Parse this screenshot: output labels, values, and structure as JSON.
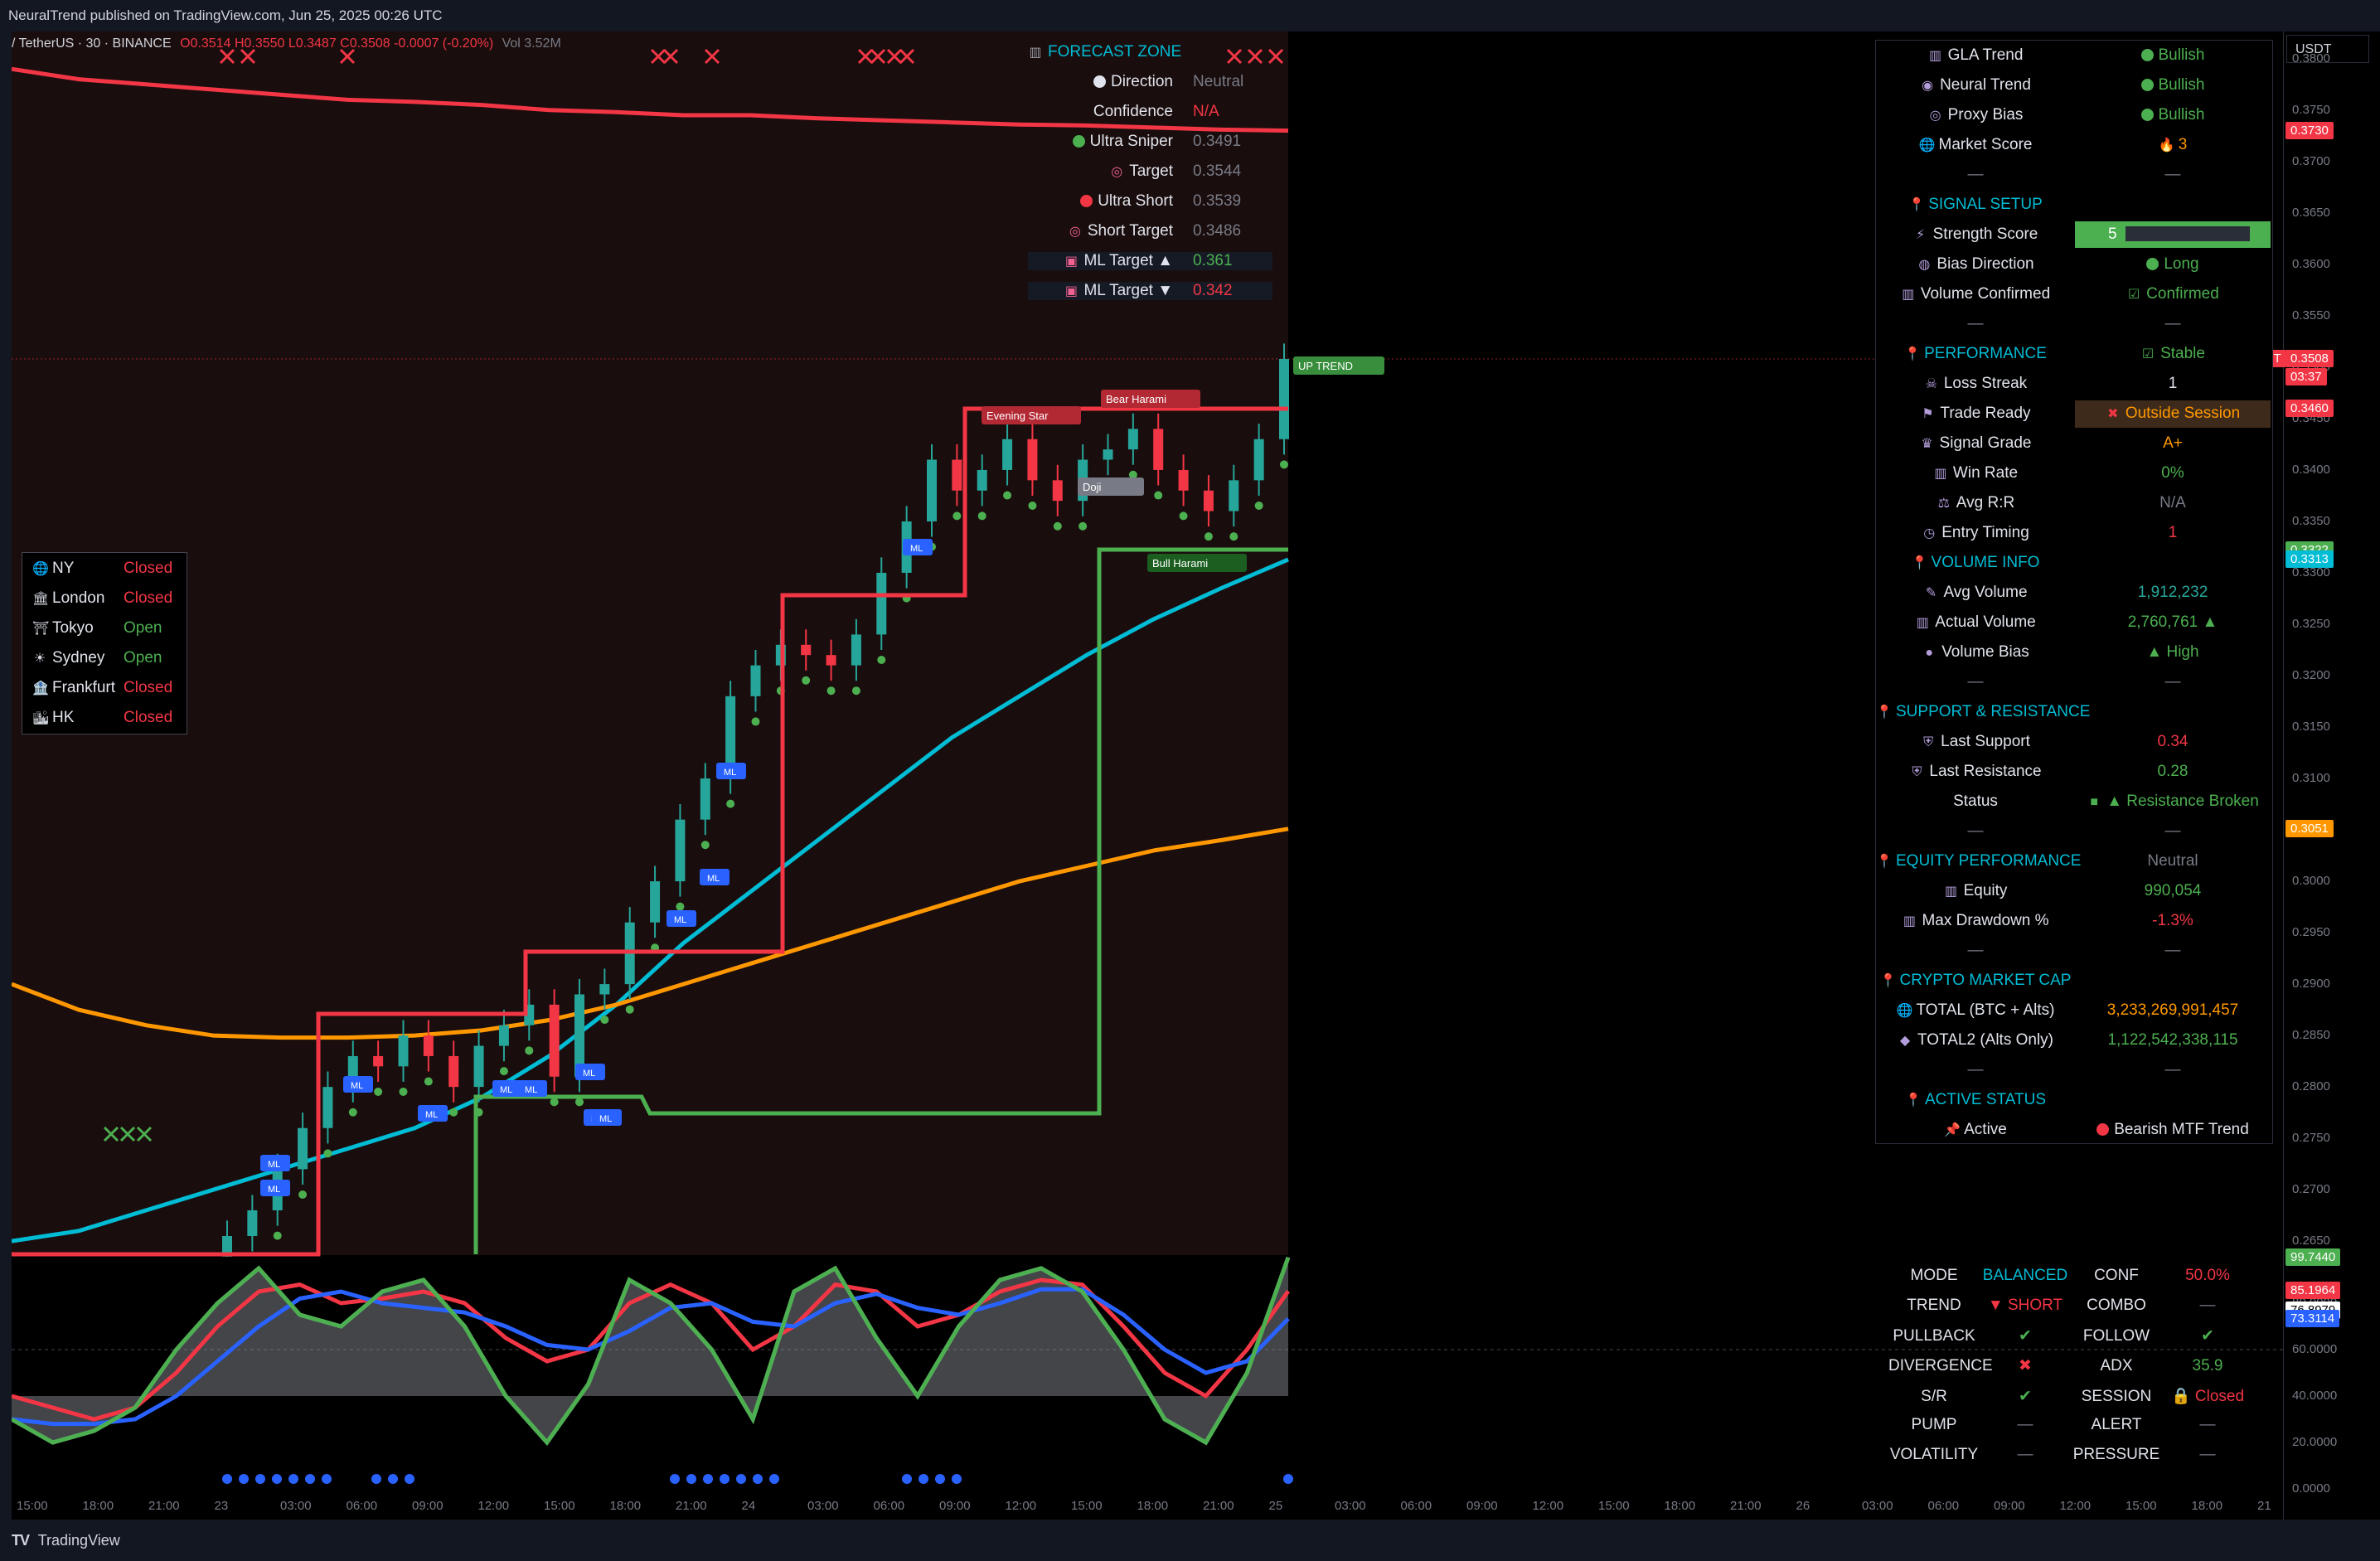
{
  "header": {
    "publisher": "NeuralTrend published on TradingView.com, Jun 25, 2025 00:26 UTC"
  },
  "symbol": {
    "name": "/ TetherUS · 30 · BINANCE",
    "ohlc": "O0.3514 H0.3550 L0.3487 C0.3508 -0.0007 (-0.20%)",
    "vol": "Vol 3.52M"
  },
  "currency": "USDT",
  "price_ticks": [
    "0.3800",
    "0.3750",
    "0.3700",
    "0.3650",
    "0.3600",
    "0.3550",
    "0.3500",
    "0.3450",
    "0.3400",
    "0.3350",
    "0.3300",
    "0.3250",
    "0.3200",
    "0.3150",
    "0.3100",
    "0.3050",
    "0.3000",
    "0.2950",
    "0.2900",
    "0.2850",
    "0.2800",
    "0.2750",
    "0.2700",
    "0.2650"
  ],
  "price_labels": [
    {
      "text": "0.3730",
      "color": "#f23645"
    },
    {
      "text": "SUSDT",
      "color": "#f23645"
    },
    {
      "text": "0.3508",
      "color": "#f23645"
    },
    {
      "text": "03:37",
      "color": "#f23645"
    },
    {
      "text": "0.3460",
      "color": "#f23645"
    },
    {
      "text": "0.3322",
      "color": "#4caf50"
    },
    {
      "text": "0.3313",
      "color": "#00bcd4"
    },
    {
      "text": "0.3051",
      "color": "#ff9800"
    }
  ],
  "osc_ticks": [
    "80.0000",
    "60.0000",
    "40.0000",
    "20.0000",
    "0.0000"
  ],
  "osc_labels": [
    {
      "text": "99.7440",
      "color": "#4caf50"
    },
    {
      "text": "85.1964",
      "color": "#f23645"
    },
    {
      "text": "76.8979",
      "color": "#ffffff",
      "fg": "#000"
    },
    {
      "text": "73.3114",
      "color": "#2962ff"
    }
  ],
  "time_axis": [
    "15:00",
    "18:00",
    "21:00",
    "23",
    "03:00",
    "06:00",
    "09:00",
    "12:00",
    "15:00",
    "18:00",
    "21:00",
    "24",
    "03:00",
    "06:00",
    "09:00",
    "12:00",
    "15:00",
    "18:00",
    "21:00",
    "25",
    "03:00",
    "06:00",
    "09:00",
    "12:00",
    "15:00",
    "18:00",
    "21:00",
    "26",
    "03:00",
    "06:00",
    "09:00",
    "12:00",
    "15:00",
    "18:00",
    "21"
  ],
  "sessions": [
    {
      "icon": "globe-icon",
      "name": "NY",
      "status": "Closed",
      "color": "#f23645"
    },
    {
      "icon": "building-icon",
      "name": "London",
      "status": "Closed",
      "color": "#f23645"
    },
    {
      "icon": "pagoda-icon",
      "name": "Tokyo",
      "status": "Open",
      "color": "#4caf50"
    },
    {
      "icon": "sun-icon",
      "name": "Sydney",
      "status": "Open",
      "color": "#4caf50"
    },
    {
      "icon": "bank-icon",
      "name": "Frankfurt",
      "status": "Closed",
      "color": "#f23645"
    },
    {
      "icon": "city-icon",
      "name": "HK",
      "status": "Closed",
      "color": "#f23645"
    }
  ],
  "forecast": {
    "title": "FORECAST ZONE",
    "rows": [
      {
        "label": "Direction",
        "value": "Neutral",
        "vcolor": "#787b86",
        "icon": "white-dot-icon",
        "dot": "#e0e3eb"
      },
      {
        "label": "Confidence",
        "value": "N/A",
        "vcolor": "#f23645"
      },
      {
        "label": "Ultra Sniper",
        "value": "0.3491",
        "vcolor": "#787b86",
        "icon": "green-dot-icon",
        "dot": "#4caf50"
      },
      {
        "label": "Target",
        "value": "0.3544",
        "vcolor": "#787b86",
        "icon": "target-icon"
      },
      {
        "label": "Ultra Short",
        "value": "0.3539",
        "vcolor": "#787b86",
        "icon": "red-dot-icon",
        "dot": "#f23645"
      },
      {
        "label": "Short Target",
        "value": "0.3486",
        "vcolor": "#787b86",
        "icon": "target-icon"
      },
      {
        "label": "ML Target ▲",
        "value": "0.361",
        "vcolor": "#4caf50",
        "icon": "ml-icon"
      },
      {
        "label": "ML Target ▼",
        "value": "0.342",
        "vcolor": "#f23645",
        "icon": "ml-icon"
      }
    ]
  },
  "dashboard": {
    "rows": [
      {
        "label": "GLA Trend",
        "value": "Bullish",
        "vcolor": "#4caf50",
        "dot": "#4caf50",
        "icon": "chart-icon"
      },
      {
        "label": "Neural Trend",
        "value": "Bullish",
        "vcolor": "#4caf50",
        "dot": "#4caf50",
        "icon": "brain-icon"
      },
      {
        "label": "Proxy Bias",
        "value": "Bullish",
        "vcolor": "#4caf50",
        "dot": "#4caf50",
        "icon": "target-icon"
      },
      {
        "label": "Market Score",
        "value": "3",
        "vcolor": "#ff9800",
        "icon": "globe-icon",
        "vicon": "fire-icon"
      },
      {
        "label": "—",
        "value": "—",
        "vcolor": "#787b86",
        "sep": true
      },
      {
        "label": "SIGNAL SETUP",
        "value": "",
        "vcolor": "#00bcd4",
        "section": true
      },
      {
        "label": "Strength Score",
        "value": "5",
        "vcolor": "#4caf50",
        "icon": "bolt-icon",
        "bar": true
      },
      {
        "label": "Bias Direction",
        "value": "Long",
        "vcolor": "#4caf50",
        "dot": "#4caf50",
        "icon": "compass-icon"
      },
      {
        "label": "Volume Confirmed",
        "value": "Confirmed",
        "vcolor": "#4caf50",
        "icon": "chart-icon",
        "vicon": "check-icon"
      },
      {
        "label": "—",
        "value": "—",
        "vcolor": "#787b86",
        "sep": true
      },
      {
        "label": "PERFORMANCE",
        "value": "Stable",
        "vcolor": "#4caf50",
        "section": true,
        "vicon": "check-icon"
      },
      {
        "label": "Loss Streak",
        "value": "1",
        "vcolor": "#e0e3eb",
        "icon": "skull-icon"
      },
      {
        "label": "Trade Ready",
        "value": "Outside Session",
        "vcolor": "#ff9800",
        "icon": "flag-icon",
        "vicon": "cross-icon",
        "hl": "#3d2a1a"
      },
      {
        "label": "Signal Grade",
        "value": "A+",
        "vcolor": "#ff9800",
        "icon": "trophy-icon"
      },
      {
        "label": "Win Rate",
        "value": "0%",
        "vcolor": "#4caf50",
        "icon": "chart-icon"
      },
      {
        "label": "Avg R:R",
        "value": "N/A",
        "vcolor": "#787b86",
        "icon": "scale-icon"
      },
      {
        "label": "Entry Timing",
        "value": "1",
        "vcolor": "#f23645",
        "icon": "clock-icon"
      },
      {
        "label": "VOLUME INFO",
        "value": "",
        "vcolor": "#00bcd4",
        "section": true
      },
      {
        "label": "Avg Volume",
        "value": "1,912,232",
        "vcolor": "#26a69a",
        "icon": "pen-icon"
      },
      {
        "label": "Actual Volume",
        "value": "2,760,761 ▲",
        "vcolor": "#4caf50",
        "icon": "chart-icon"
      },
      {
        "label": "Volume Bias",
        "value": "▲ High",
        "vcolor": "#4caf50",
        "icon": "drop-icon"
      },
      {
        "label": "—",
        "value": "—",
        "vcolor": "#787b86",
        "sep": true
      },
      {
        "label": "SUPPORT & RESISTANCE",
        "value": "",
        "vcolor": "#00bcd4",
        "section": true
      },
      {
        "label": "Last Support",
        "value": "0.34",
        "vcolor": "#f23645",
        "icon": "shield-icon"
      },
      {
        "label": "Last Resistance",
        "value": "0.28",
        "vcolor": "#4caf50",
        "icon": "shield-icon"
      },
      {
        "label": "Status",
        "value": "▲ Resistance Broken",
        "vcolor": "#4caf50",
        "vicon": "square-icon"
      },
      {
        "label": "—",
        "value": "—",
        "vcolor": "#787b86",
        "sep": true
      },
      {
        "label": "EQUITY PERFORMANCE",
        "value": "Neutral",
        "vcolor": "#787b86",
        "section": true
      },
      {
        "label": "Equity",
        "value": "990,054",
        "vcolor": "#4caf50",
        "icon": "chart-icon"
      },
      {
        "label": "Max Drawdown %",
        "value": "-1.3%",
        "vcolor": "#f23645",
        "icon": "chart-icon"
      },
      {
        "label": "—",
        "value": "—",
        "vcolor": "#787b86",
        "sep": true
      },
      {
        "label": "CRYPTO MARKET CAP",
        "value": "",
        "vcolor": "#00bcd4",
        "section": true
      },
      {
        "label": "TOTAL (BTC + Alts)",
        "value": "3,233,269,991,457",
        "vcolor": "#ff9800",
        "icon": "globe-icon"
      },
      {
        "label": "TOTAL2 (Alts Only)",
        "value": "1,122,542,338,115",
        "vcolor": "#4caf50",
        "icon": "diamond-icon"
      },
      {
        "label": "—",
        "value": "—",
        "vcolor": "#787b86",
        "sep": true
      },
      {
        "label": "ACTIVE STATUS",
        "value": "",
        "vcolor": "#00bcd4",
        "section": true
      },
      {
        "label": "Active",
        "value": "Bearish MTF Trend",
        "vcolor": "#e0e3eb",
        "dot": "#f23645",
        "icon": "pin-icon"
      }
    ]
  },
  "oscillator_table": [
    {
      "k1": "MODE",
      "v1": "BALANCED",
      "c1": "#00bcd4",
      "k2": "CONF",
      "v2": "50.0%",
      "c2": "#f23645"
    },
    {
      "k1": "TREND",
      "v1": "▼ SHORT",
      "c1": "#f23645",
      "k2": "COMBO",
      "v2": "—",
      "c2": "#787b86"
    },
    {
      "k1": "PULLBACK",
      "v1": "✔",
      "c1": "#4caf50",
      "k2": "FOLLOW",
      "v2": "✔",
      "c2": "#4caf50"
    },
    {
      "k1": "DIVERGENCE",
      "v1": "✖",
      "c1": "#f23645",
      "k2": "ADX",
      "v2": "35.9",
      "c2": "#4caf50"
    },
    {
      "k1": "S/R",
      "v1": "✔",
      "c1": "#4caf50",
      "k2": "SESSION",
      "v2": "🔒 Closed",
      "c2": "#f23645"
    },
    {
      "k1": "PUMP",
      "v1": "—",
      "c1": "#787b86",
      "k2": "ALERT",
      "v2": "—",
      "c2": "#787b86"
    },
    {
      "k1": "VOLATILITY",
      "v1": "—",
      "c1": "#787b86",
      "k2": "PRESSURE",
      "v2": "—",
      "c2": "#787b86"
    }
  ],
  "chart_labels": {
    "evening_star": "Evening Star",
    "bear_harami": "Bear Harami",
    "bull_harami": "Bull Harami",
    "doji": "Doji",
    "up_trend": "UP TREND",
    "ml": "ML"
  },
  "footer": {
    "brand": "TradingView"
  },
  "chart_data": {
    "type": "line",
    "candles_close": [
      0.2655,
      0.268,
      0.272,
      0.276,
      0.28,
      0.283,
      0.282,
      0.285,
      0.283,
      0.28,
      0.284,
      0.286,
      0.288,
      0.281,
      0.289,
      0.29,
      0.296,
      0.3,
      0.306,
      0.31,
      0.318,
      0.321,
      0.323,
      0.322,
      0.321,
      0.324,
      0.33,
      0.335,
      0.341,
      0.338,
      0.34,
      0.343,
      0.339,
      0.337,
      0.341,
      0.342,
      0.344,
      0.34,
      0.338,
      0.336,
      0.339,
      0.343,
      0.3508
    ],
    "series": [
      {
        "name": "red trail",
        "values": [
          0.379,
          0.378,
          0.3775,
          0.377,
          0.3765,
          0.376,
          0.3758,
          0.3755,
          0.375,
          0.3748,
          0.3745,
          0.3745,
          0.3742,
          0.374,
          0.3738,
          0.3736,
          0.3735,
          0.3733,
          0.3731,
          0.373
        ]
      },
      {
        "name": "cyan ma",
        "values": [
          0.265,
          0.266,
          0.268,
          0.27,
          0.272,
          0.274,
          0.276,
          0.279,
          0.283,
          0.288,
          0.294,
          0.299,
          0.304,
          0.309,
          0.314,
          0.318,
          0.322,
          0.3255,
          0.3285,
          0.3313
        ]
      },
      {
        "name": "orange ma",
        "values": [
          0.29,
          0.2875,
          0.286,
          0.285,
          0.2848,
          0.2848,
          0.285,
          0.2855,
          0.2865,
          0.288,
          0.29,
          0.292,
          0.294,
          0.296,
          0.298,
          0.3,
          0.3015,
          0.303,
          0.304,
          0.3051
        ]
      }
    ],
    "oscillator": {
      "green": [
        30,
        20,
        25,
        35,
        60,
        80,
        95,
        75,
        70,
        85,
        90,
        70,
        40,
        20,
        45,
        90,
        80,
        60,
        30,
        85,
        95,
        65,
        40,
        70,
        90,
        95,
        85,
        60,
        30,
        20,
        50,
        99.7
      ],
      "red": [
        40,
        35,
        30,
        35,
        50,
        70,
        85,
        88,
        80,
        82,
        85,
        80,
        65,
        55,
        60,
        80,
        88,
        80,
        60,
        70,
        88,
        85,
        70,
        75,
        85,
        90,
        88,
        70,
        50,
        40,
        60,
        85.2
      ],
      "blue": [
        30,
        28,
        28,
        30,
        40,
        55,
        70,
        82,
        85,
        80,
        78,
        76,
        70,
        62,
        60,
        68,
        78,
        80,
        72,
        70,
        80,
        84,
        78,
        75,
        80,
        86,
        86,
        75,
        60,
        50,
        55,
        73.3
      ]
    },
    "ylim": [
      0.263,
      0.382
    ]
  }
}
